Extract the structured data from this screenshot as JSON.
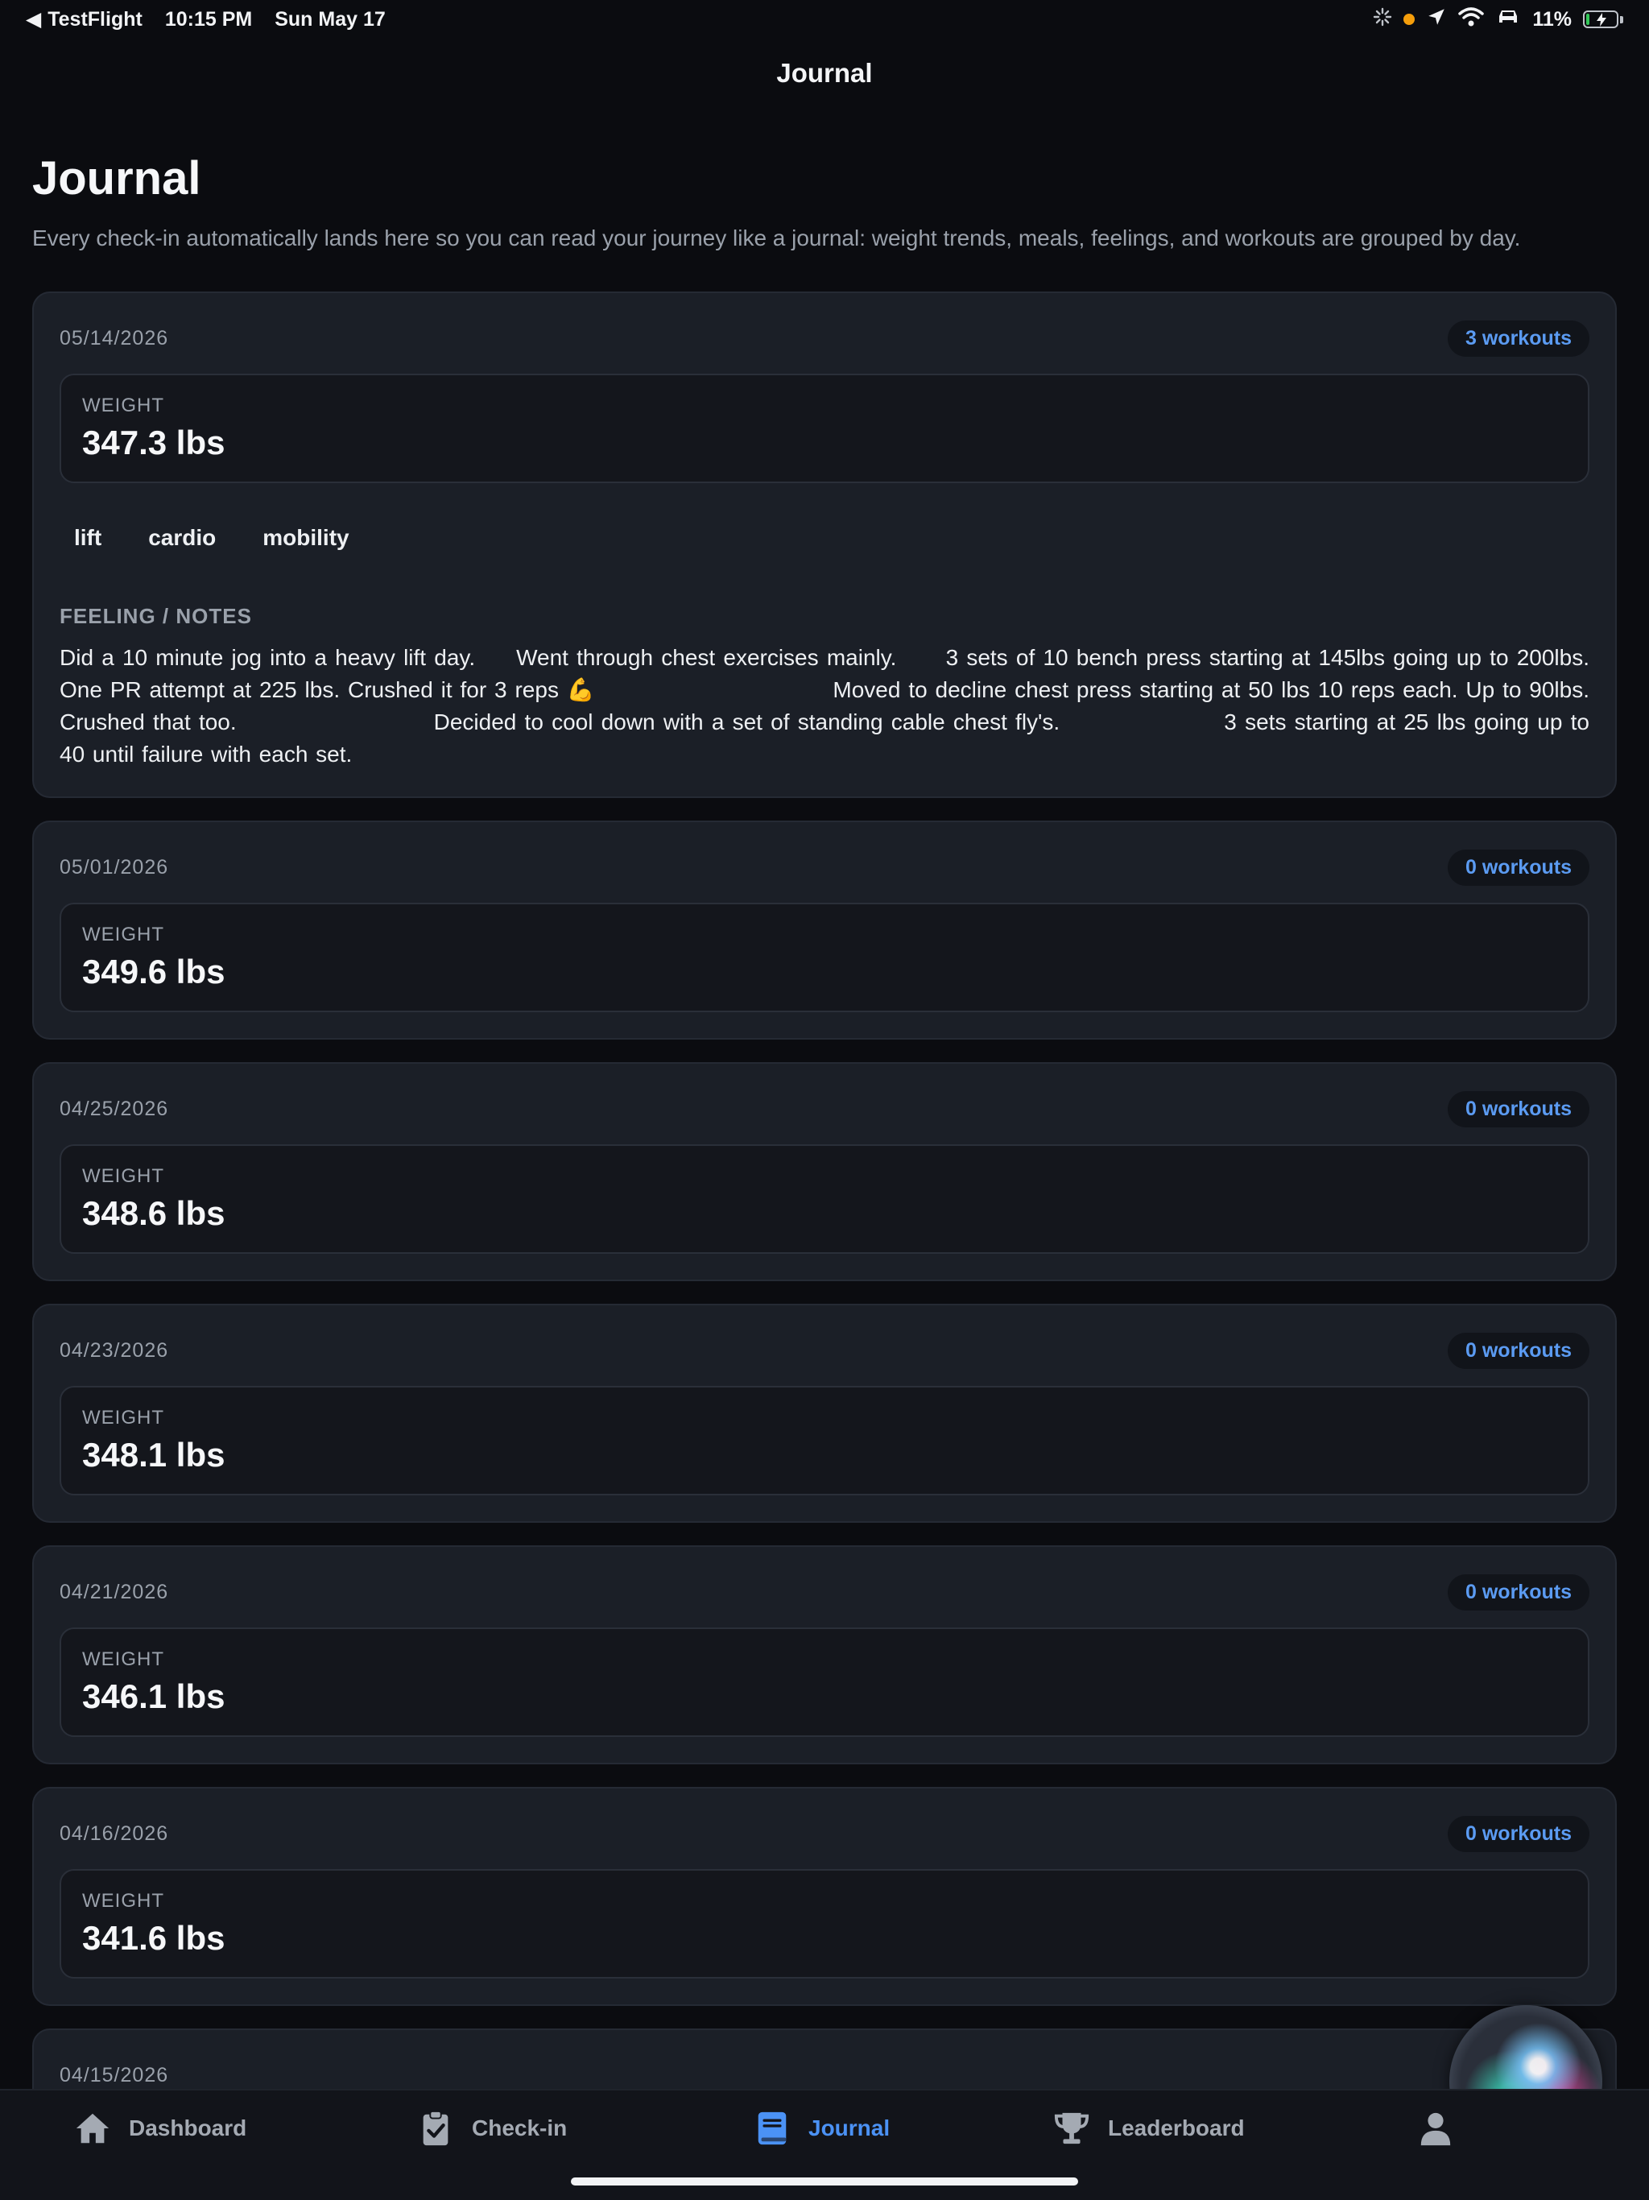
{
  "status_bar": {
    "back_app": "TestFlight",
    "time": "10:15 PM",
    "date": "Sun May 17",
    "battery": "11%",
    "battery_level": 0.11,
    "icons": [
      "back-arrow-icon",
      "activity-spinner-icon",
      "orange-dot-icon",
      "location-arrow-icon",
      "wifi-icon",
      "car-icon",
      "battery-charging-icon"
    ],
    "colors": {
      "indicator": "#f59e0b",
      "battery_fill": "#34c759"
    }
  },
  "nav": {
    "title": "Journal"
  },
  "header": {
    "title": "Journal",
    "subtitle": "Every check-in automatically lands here so you can read your journey like a journal: weight trends, meals, feelings, and workouts are grouped by day."
  },
  "weight_label": "WEIGHT",
  "notes_label": "FEELING / NOTES",
  "entries": [
    {
      "date": "05/14/2026",
      "workouts": "3 workouts",
      "weight": "347.3 lbs",
      "tags": [
        "lift",
        "cardio",
        "mobility"
      ],
      "notes": "Did a 10 minute jog into a heavy lift day.     Went through chest exercises mainly.      3 sets of 10 bench press starting at 145lbs going up to 200lbs. One PR attempt at 225 lbs. Crushed it for 3 reps 💪                              Moved to decline chest press starting at 50 lbs 10 reps each. Up to 90lbs. Crushed that too.                        Decided to cool down with a set of standing cable chest fly's.                    3 sets starting at 25 lbs going up to 40 until failure with each set."
    },
    {
      "date": "05/01/2026",
      "workouts": "0 workouts",
      "weight": "349.6 lbs"
    },
    {
      "date": "04/25/2026",
      "workouts": "0 workouts",
      "weight": "348.6 lbs"
    },
    {
      "date": "04/23/2026",
      "workouts": "0 workouts",
      "weight": "348.1 lbs"
    },
    {
      "date": "04/21/2026",
      "workouts": "0 workouts",
      "weight": "346.1 lbs"
    },
    {
      "date": "04/16/2026",
      "workouts": "0 workouts",
      "weight": "341.6 lbs"
    },
    {
      "date": "04/15/2026"
    }
  ],
  "tabs": [
    {
      "label": "Dashboard",
      "icon": "home-icon"
    },
    {
      "label": "Check-in",
      "icon": "clipboard-check-icon"
    },
    {
      "label": "Journal",
      "icon": "book-icon",
      "active": true
    },
    {
      "label": "Leaderboard",
      "icon": "trophy-icon"
    },
    {
      "label": "",
      "icon": "user-icon"
    }
  ],
  "colors": {
    "accent": "#4b92f5",
    "badge_text": "#5b9bf2",
    "background": "#0b0c10",
    "card": "#1b1f27"
  }
}
